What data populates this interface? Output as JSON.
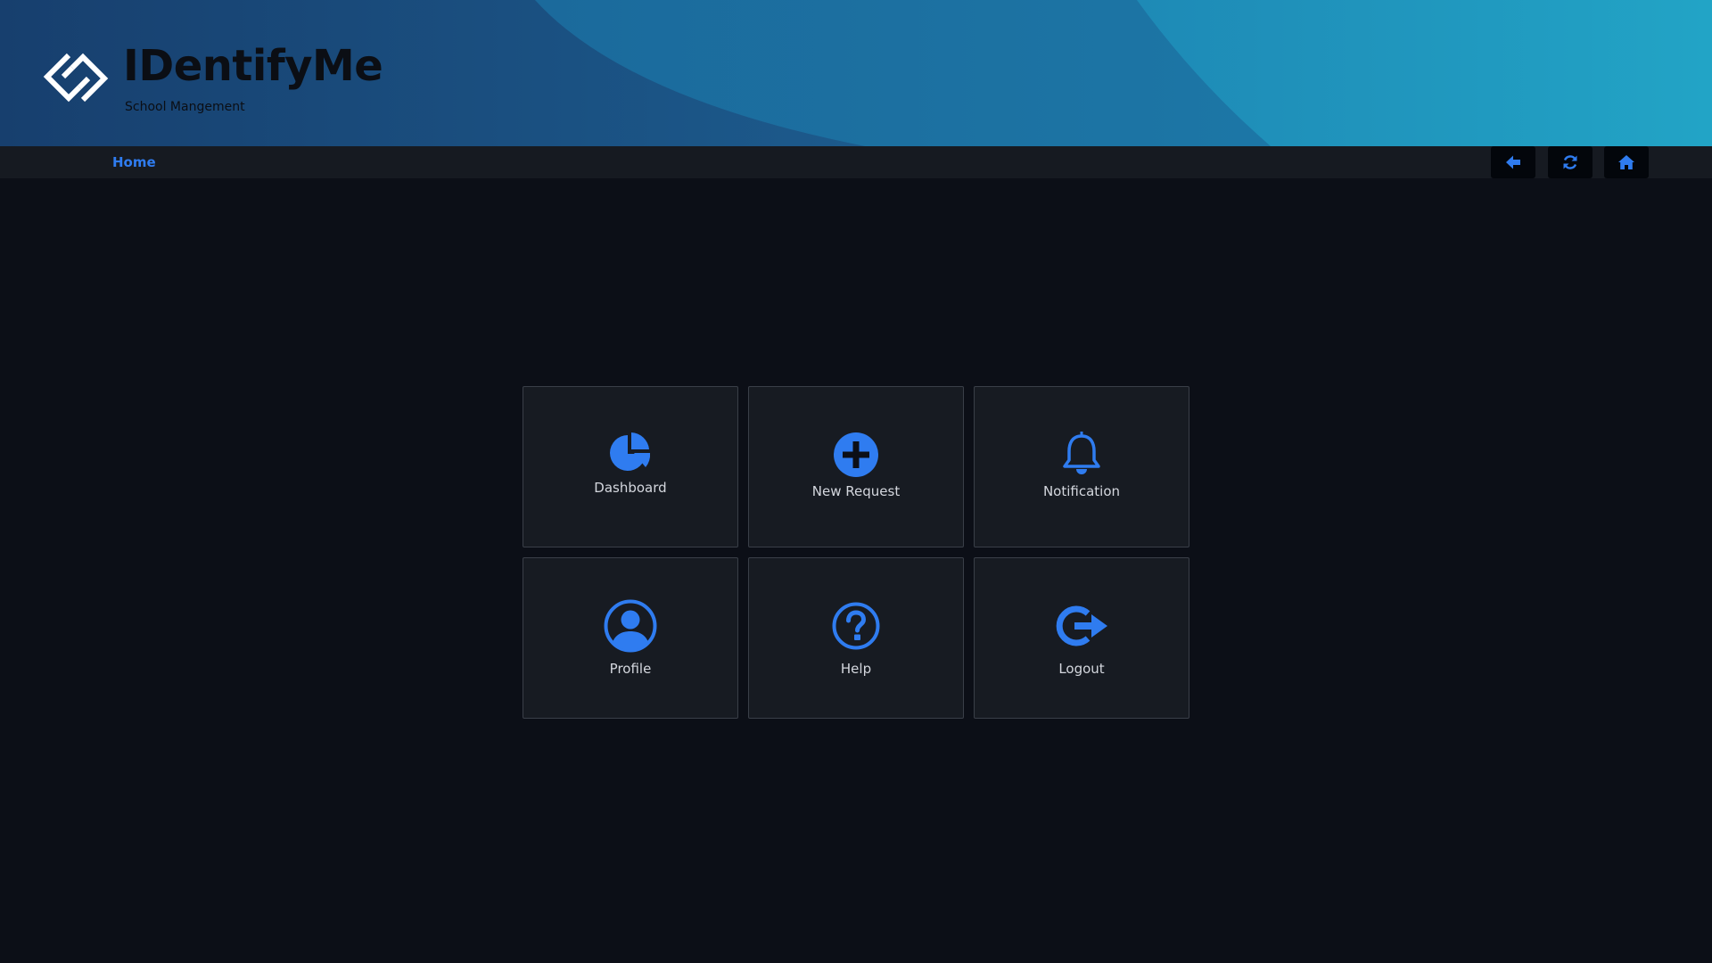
{
  "brand": {
    "title": "IDentifyMe",
    "subtitle": "School Mangement"
  },
  "nav": {
    "home_label": "Home",
    "buttons": [
      {
        "name": "back",
        "icon": "arrow-left-icon"
      },
      {
        "name": "refresh",
        "icon": "refresh-icon"
      },
      {
        "name": "home",
        "icon": "home-icon"
      }
    ]
  },
  "tiles": [
    {
      "label": "Dashboard",
      "icon": "pie-chart-icon"
    },
    {
      "label": "New Request",
      "icon": "plus-circle-icon"
    },
    {
      "label": "Notification",
      "icon": "bell-icon"
    },
    {
      "label": "Profile",
      "icon": "user-circle-icon"
    },
    {
      "label": "Help",
      "icon": "question-circle-icon"
    },
    {
      "label": "Logout",
      "icon": "sign-out-icon"
    }
  ],
  "colors": {
    "accent": "#2f7cf0",
    "background": "#0c0f17",
    "tile_background": "#171b22",
    "navbar": "#161a21",
    "banner_dark": "#1b4d7e",
    "banner_light": "#1fa0c3"
  }
}
